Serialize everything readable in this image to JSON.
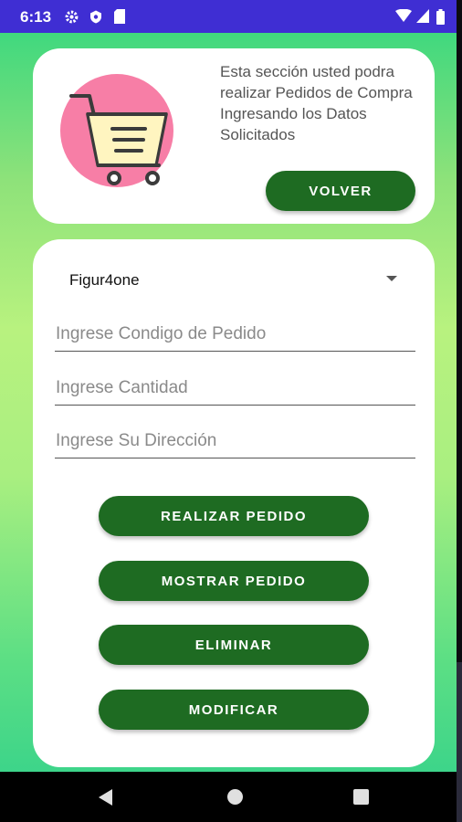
{
  "status_bar": {
    "time": "6:13",
    "icons": [
      "gear-icon",
      "shield-icon",
      "sd-card-icon",
      "wifi-icon",
      "signal-icon",
      "battery-icon"
    ]
  },
  "header_card": {
    "description": "Esta sección usted podra realizar Pedidos de Compra Ingresando los Datos Solicitados",
    "illustration": "shopping-cart-icon",
    "back_button_label": "VOLVER"
  },
  "form": {
    "spinner_value": "Figur4one",
    "order_code_placeholder": "Ingrese Condigo de Pedido",
    "quantity_placeholder": "Ingrese Cantidad",
    "address_placeholder": "Ingrese Su Dirección"
  },
  "actions": {
    "place_order_label": "REALIZAR PEDIDO",
    "show_order_label": "MOSTRAR PEDIDO",
    "delete_label": "ELIMINAR",
    "modify_label": "MODIFICAR"
  },
  "nav_bar": {
    "icons": [
      "back-icon",
      "home-icon",
      "recents-icon"
    ]
  },
  "colors": {
    "status_bar": "#3f2ed3",
    "button": "#1e6b22",
    "cart_circle": "#f77ea6",
    "cart_fill": "#fff5c0"
  }
}
